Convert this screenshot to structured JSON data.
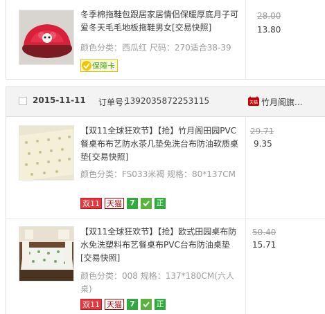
{
  "top_item": {
    "title": "冬季棉拖鞋包跟居家居情侣保暖厚底月子可爱冬天毛毛地板拖鞋男女[交易快照]",
    "sku": "颜色分类：西瓜红  尺码：270适合38-39",
    "price_original": "28.00",
    "price_now": "13.80",
    "guarantee_label": "保障卡",
    "thumb_icon": "red-slipper-image"
  },
  "order": {
    "date": "2015-11-11",
    "order_no_label": "订单号：",
    "order_no": "1392035872253115",
    "shop_name": "竹月阁旗...",
    "shop_icon": "tmall-cat-icon",
    "items": [
      {
        "title": "【双11全球狂欢节】【抢】竹月阁田园PVC餐桌布布艺防水茶几垫免洗台布防油软质桌垫[交易快照]",
        "sku": "颜色分类：FS033米褐  规格：80*137CM",
        "price_original": "29.71",
        "price_now": "9.35",
        "thumb_icon": "tablecloth-image",
        "badges": {
          "double11": "双11",
          "tmall": "天猫",
          "seven": "7",
          "zheng": "正"
        }
      },
      {
        "title": "【双11全球狂欢节】【抢】欧式田园桌布防水免洗塑料布艺餐桌布PVC台布防油桌垫[交易快照]",
        "sku": "颜色分类：008  规格：137*180CM(六人桌)",
        "price_original": "50.40",
        "price_now": "15.71",
        "thumb_icon": "dining-table-image",
        "badges": {
          "double11": "双11",
          "tmall": "天猫",
          "seven": "7",
          "zheng": "正"
        }
      }
    ]
  },
  "colors": {
    "accent_red": "#c40000",
    "green": "#2faa3c",
    "muted_text": "#9c9c9c"
  }
}
